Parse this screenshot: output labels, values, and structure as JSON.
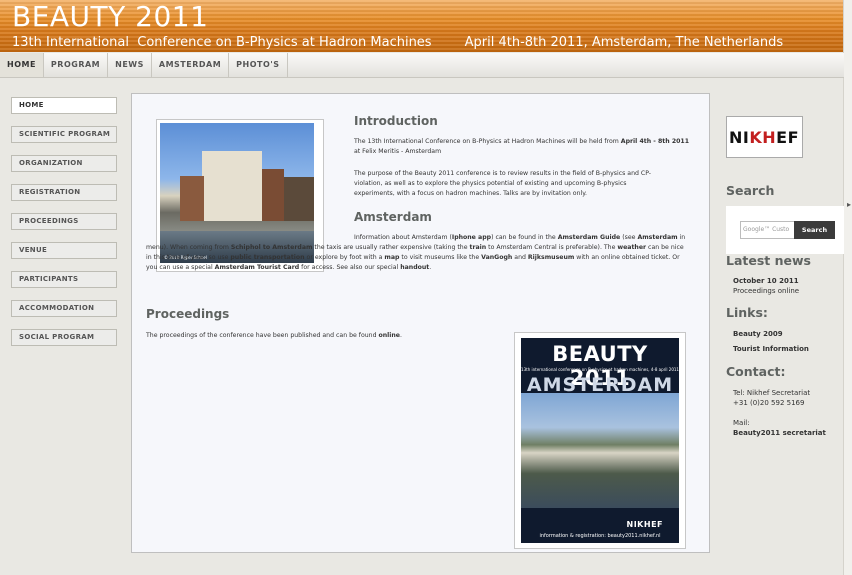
{
  "header": {
    "title": "BEAUTY 2011",
    "subtitle": "13th International  Conference on B-Physics at Hadron Machines        April 4th-8th 2011, Amsterdam, The Netherlands"
  },
  "topnav": [
    "HOME",
    "PROGRAM",
    "NEWS",
    "AMSTERDAM",
    "PHOTO'S"
  ],
  "sidebar": [
    "HOME",
    "SCIENTIFIC PROGRAM",
    "ORGANIZATION",
    "REGISTRATION",
    "PROCEEDINGS",
    "VENUE",
    "PARTICIPANTS",
    "ACCOMMODATION",
    "SOCIAL PROGRAM"
  ],
  "main": {
    "photo_caption": "© 2010 Rijper Schoel",
    "intro_title": "Introduction",
    "intro_p1_a": "The 13th International Conference on B-Physics at Hadron Machines will be held from ",
    "intro_p1_b": "April  4th - 8th 2011",
    "intro_p1_c": " at Felix Meritis - Amsterdam",
    "intro_p2": "The purpose of the Beauty 2011 conference is to review results in the field of B-physics and CP-violation, as well as to explore the physics potential of existing and upcoming B-physics experiments, with a focus on hadron machines. Talks are by invitation only.",
    "ams_title": "Amsterdam",
    "ams_1": "Information about Amsterdam (",
    "ams_2": "Iphone app",
    "ams_3": ") can be found in the ",
    "ams_4": "Amsterdam Guide",
    "ams_5": " (see ",
    "ams_6": "Amsterdam",
    "ams_7": " in menu). When coming from ",
    "ams_8": "Schiphol to Amsterdam",
    "ams_9": " the taxis are usually rather expensive (taking the ",
    "ams_10": "train",
    "ams_11": " to Amsterdam Central is preferable). The ",
    "ams_12": "weather",
    "ams_13": " can be nice in this time of year, so use ",
    "ams_14": "public transportation",
    "ams_15": " or explore by foot with a ",
    "ams_16": "map",
    "ams_17": " to visit museums like the ",
    "ams_18": "VanGogh",
    "ams_19": " and ",
    "ams_20": "Rijksmuseum",
    "ams_21": " with an online obtained ticket.  Or you can use a special ",
    "ams_22": "Amsterdam Tourist Card",
    "ams_23": " for access. See also our special ",
    "ams_24": "handout",
    "ams_25": ".",
    "proc_title": "Proceedings",
    "proc_a": "The proceedings of the conference have been published and can be found ",
    "proc_b": "online",
    "proc_c": ".",
    "poster": {
      "title": "BEAUTY 2011",
      "subtitle": "13th international conference on B-physics at hadron machines, 4-8 april 2011",
      "city": "AMSTERDAM",
      "info": "information & registration: beauty2011.nikhef.nl",
      "logo": "NIKHEF"
    }
  },
  "right": {
    "logo": {
      "a": "NI",
      "b": "K",
      "c": "H",
      "d": "EF"
    },
    "search_title": "Search",
    "search_placeholder": "Google™ Custo",
    "search_button": "Search",
    "news_title": "Latest news",
    "news_date": "October 10 2011",
    "news_text": "Proceedings  online",
    "links_title": "Links:",
    "link1": "Beauty 2009",
    "link2": "Tourist Information",
    "contact_title": "Contact:",
    "tel_label": "Tel: Nikhef Secretariat",
    "tel": "+31 (0)20 592 5169",
    "mail_label": "Mail:",
    "mail": "Beauty2011 secretariat"
  },
  "colors": {
    "header": "#d8791a",
    "heading": "#5f6361",
    "nikhef_red": "#c21f1f"
  }
}
